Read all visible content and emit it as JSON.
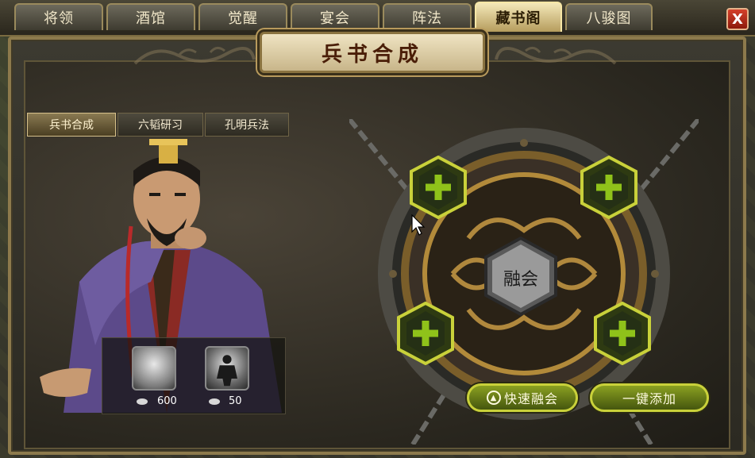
{
  "tabs": [
    {
      "label": "将领"
    },
    {
      "label": "酒馆"
    },
    {
      "label": "觉醒"
    },
    {
      "label": "宴会"
    },
    {
      "label": "阵法"
    },
    {
      "label": "藏书阁"
    },
    {
      "label": "八骏图"
    }
  ],
  "active_tab": "藏书阁",
  "close_label": "X",
  "panel_title": "兵书合成",
  "subtabs": [
    {
      "label": "兵书合成"
    },
    {
      "label": "六韬研习"
    },
    {
      "label": "孔明兵法"
    }
  ],
  "items": [
    {
      "icon": "silver-scroll-icon",
      "count": "600"
    },
    {
      "icon": "silhouette-token-icon",
      "count": "50"
    }
  ],
  "fuse_label": "融会",
  "quick_fuse_label": "快速融会",
  "one_click_add_label": "一键添加",
  "colors": {
    "accent": "#c9d13a",
    "plus_green": "#8fc21a",
    "title_plate": "#efe4c2",
    "close_red": "#d4402a"
  }
}
